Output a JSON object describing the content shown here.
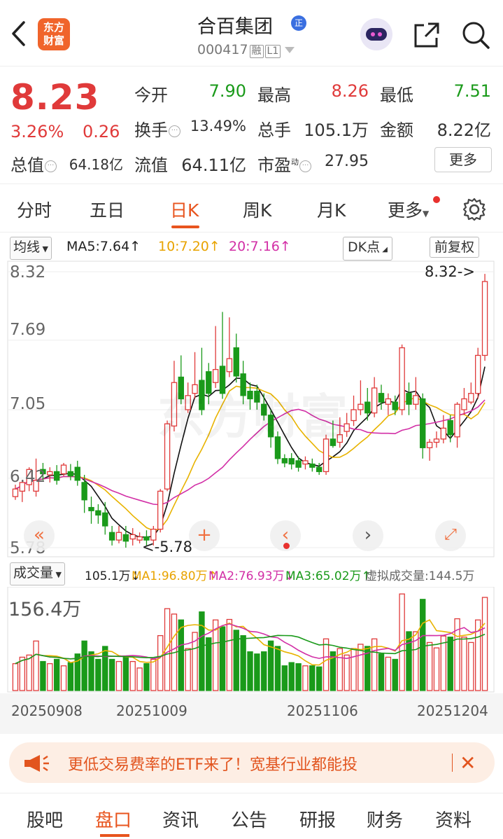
{
  "header": {
    "logo_line1": "东方",
    "logo_line2": "财富",
    "stock_name": "合百集团",
    "zheng_badge": "正",
    "stock_code": "000417",
    "tag_rong": "融",
    "tag_l1": "L1",
    "icons": [
      "back-icon",
      "robot-avatar-icon",
      "share-icon",
      "search-icon"
    ]
  },
  "quote": {
    "price": "8.23",
    "change_pct": "3.26%",
    "change": "0.26",
    "open_label": "今开",
    "open": "7.90",
    "high_label": "最高",
    "high": "8.26",
    "low_label": "最低",
    "low": "7.51",
    "turnover_label": "换手",
    "turnover": "13.49%",
    "volume_label": "总手",
    "volume": "105.1万",
    "amount_label": "金额",
    "amount": "8.22亿",
    "mktcap_label": "总值",
    "mktcap": "64.18亿",
    "float_label": "流值",
    "float_cap": "64.11亿",
    "pe_label": "市盈",
    "pe_sup": "动",
    "pe": "27.95",
    "more_button": "更多",
    "colors": {
      "up": "#e03a3a",
      "down": "#1a9a1a"
    }
  },
  "tabs": {
    "items": [
      "分时",
      "五日",
      "日K",
      "周K",
      "月K",
      "更多"
    ],
    "active": "日K"
  },
  "indicators": {
    "ma_select": "均线",
    "ma5": "MA5:7.64",
    "ma10": "10:7.20",
    "ma20": "20:7.16",
    "dk_point": "DK点",
    "adjust": "前复权",
    "vol_select": "成交量",
    "vol_value": "105.1万",
    "vol_ma1": "MA1:96.80万",
    "vol_ma2": "MA2:76.93万",
    "vol_ma3": "MA3:65.02万",
    "vol_virtual": "虚拟成交量:144.5万"
  },
  "chart_data": {
    "type": "candlestick",
    "y_ticks": [
      "8.32",
      "7.69",
      "7.05",
      "6.42",
      "5.78"
    ],
    "ylim": [
      5.78,
      8.32
    ],
    "max_marker": "8.32->",
    "min_marker": "<-5.78",
    "watermark": "东方财富",
    "candles": [
      [
        6.25,
        6.32,
        6.36,
        6.22
      ],
      [
        6.3,
        6.38,
        6.4,
        6.2
      ],
      [
        6.36,
        6.5,
        6.52,
        6.3
      ],
      [
        6.3,
        6.4,
        6.6,
        6.25
      ],
      [
        6.5,
        6.46,
        6.56,
        6.4
      ],
      [
        6.45,
        6.48,
        6.52,
        6.38
      ],
      [
        6.48,
        6.4,
        6.54,
        6.36
      ],
      [
        6.46,
        6.54,
        6.56,
        6.44
      ],
      [
        6.48,
        6.44,
        6.55,
        6.4
      ],
      [
        6.52,
        6.4,
        6.58,
        6.35
      ],
      [
        6.38,
        6.22,
        6.45,
        6.1
      ],
      [
        6.15,
        6.12,
        6.25,
        6.0
      ],
      [
        6.12,
        6.08,
        6.18,
        6.0
      ],
      [
        6.1,
        5.98,
        6.2,
        5.9
      ],
      [
        5.92,
        5.85,
        5.98,
        5.8
      ],
      [
        5.85,
        5.92,
        5.98,
        5.82
      ],
      [
        5.9,
        5.84,
        5.98,
        5.78
      ],
      [
        5.86,
        5.9,
        5.96,
        5.8
      ],
      [
        5.85,
        5.88,
        5.92,
        5.82
      ],
      [
        5.88,
        5.85,
        5.94,
        5.8
      ],
      [
        5.85,
        5.95,
        5.98,
        5.8
      ],
      [
        5.95,
        6.3,
        6.32,
        5.92
      ],
      [
        6.32,
        6.92,
        6.95,
        6.3
      ],
      [
        6.9,
        7.3,
        7.5,
        6.85
      ],
      [
        7.35,
        7.15,
        7.55,
        7.1
      ],
      [
        7.05,
        7.18,
        7.3,
        7.02
      ],
      [
        7.2,
        7.28,
        7.58,
        7.15
      ],
      [
        7.32,
        7.05,
        7.62,
        7.0
      ],
      [
        7.4,
        7.2,
        7.48,
        7.1
      ],
      [
        7.3,
        7.42,
        7.82,
        7.25
      ],
      [
        7.45,
        7.2,
        7.95,
        7.15
      ],
      [
        7.4,
        7.52,
        7.9,
        7.35
      ],
      [
        7.62,
        7.36,
        7.75,
        7.3
      ],
      [
        7.38,
        7.18,
        7.5,
        7.1
      ],
      [
        7.22,
        7.15,
        7.3,
        7.05
      ],
      [
        7.22,
        7.12,
        7.28,
        7.05
      ],
      [
        7.1,
        7.0,
        7.2,
        6.95
      ],
      [
        7.0,
        6.8,
        7.05,
        6.7
      ],
      [
        6.8,
        6.6,
        6.85,
        6.55
      ],
      [
        6.6,
        6.56,
        6.64,
        6.52
      ],
      [
        6.6,
        6.55,
        6.65,
        6.5
      ],
      [
        6.58,
        6.52,
        6.62,
        6.48
      ],
      [
        6.55,
        6.58,
        6.62,
        6.5
      ],
      [
        6.55,
        6.52,
        6.6,
        6.48
      ],
      [
        6.52,
        6.48,
        6.56,
        6.45
      ],
      [
        6.48,
        6.78,
        6.82,
        6.45
      ],
      [
        6.78,
        6.72,
        6.95,
        6.7
      ],
      [
        6.75,
        6.82,
        6.98,
        6.7
      ],
      [
        6.85,
        6.92,
        7.02,
        6.8
      ],
      [
        6.95,
        7.05,
        7.18,
        6.9
      ],
      [
        7.05,
        7.1,
        7.32,
        7.0
      ],
      [
        7.12,
        7.02,
        7.25,
        6.95
      ],
      [
        7.02,
        7.25,
        7.35,
        6.98
      ],
      [
        7.2,
        7.12,
        7.28,
        7.05
      ],
      [
        7.1,
        7.15,
        7.2,
        7.0
      ],
      [
        7.12,
        7.05,
        7.18,
        7.0
      ],
      [
        7.05,
        7.62,
        7.65,
        7.0
      ],
      [
        7.2,
        7.1,
        7.3,
        7.0
      ],
      [
        7.1,
        7.18,
        7.35,
        7.05
      ],
      [
        7.15,
        6.7,
        7.2,
        6.6
      ],
      [
        6.7,
        6.75,
        6.78,
        6.58
      ],
      [
        6.75,
        6.78,
        6.85,
        6.7
      ],
      [
        6.78,
        6.88,
        7.0,
        6.74
      ],
      [
        6.95,
        6.82,
        7.0,
        6.75
      ],
      [
        6.8,
        7.1,
        7.12,
        6.7
      ],
      [
        7.05,
        7.15,
        7.25,
        7.0
      ],
      [
        7.12,
        7.2,
        7.3,
        7.1
      ],
      [
        7.2,
        7.55,
        7.62,
        7.15
      ],
      [
        7.55,
        8.23,
        8.3,
        7.5
      ]
    ]
  },
  "volume_chart": {
    "y_label": "156.4万",
    "dates": [
      "20250908",
      "20251009",
      "20251106",
      "20251204"
    ]
  },
  "chart_controls": {
    "left_left": "«",
    "plus": "+",
    "prev": "‹",
    "next": "›",
    "expand": "⤢"
  },
  "banner": {
    "text": "更低交易费率的ETF来了！宽基行业都能投",
    "close": "✕"
  },
  "bottom_nav": {
    "items": [
      "股吧",
      "盘口",
      "资讯",
      "公告",
      "研报",
      "财务",
      "资料"
    ],
    "active": "盘口"
  }
}
